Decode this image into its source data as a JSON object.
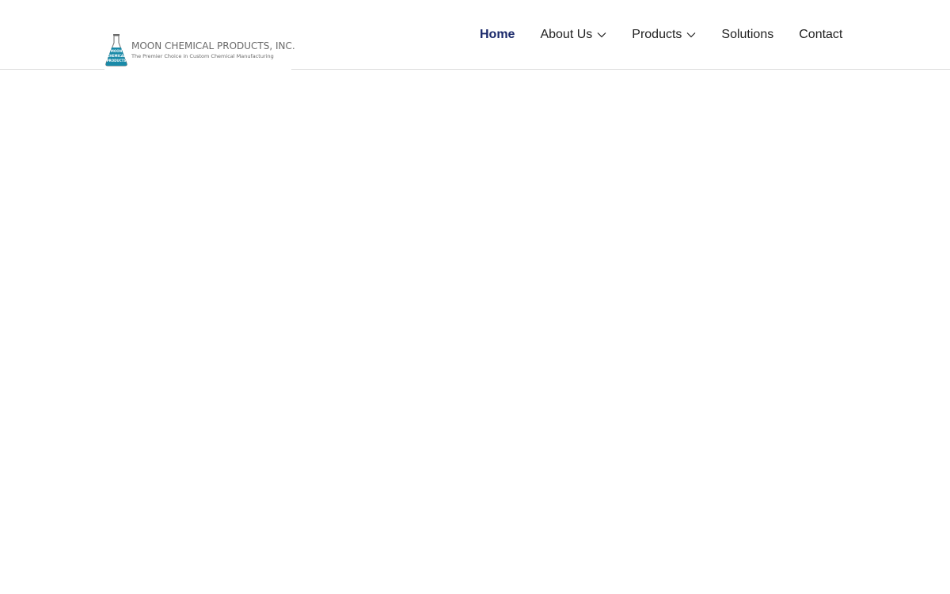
{
  "header": {
    "logo": {
      "icon": "erlenmeyer-flask-logo-icon",
      "name": "MOON CHEMICAL PRODUCTS, INC.",
      "tagline": "The Premier Choice in Custom Chemical Manufacturing",
      "mark_lines": [
        "MOON",
        "CHEMICAL",
        "PRODUCTS"
      ],
      "brand_color": "#1a8aa8"
    },
    "nav": {
      "active_color": "#1b2a6b",
      "items": [
        {
          "label": "Home",
          "active": true
        },
        {
          "label": "About Us",
          "dropdown": true,
          "icon": "chevron-down-icon"
        },
        {
          "label": "Products",
          "dropdown": true,
          "icon": "chevron-down-icon"
        },
        {
          "label": "Solutions"
        },
        {
          "label": "Contact"
        }
      ]
    }
  }
}
